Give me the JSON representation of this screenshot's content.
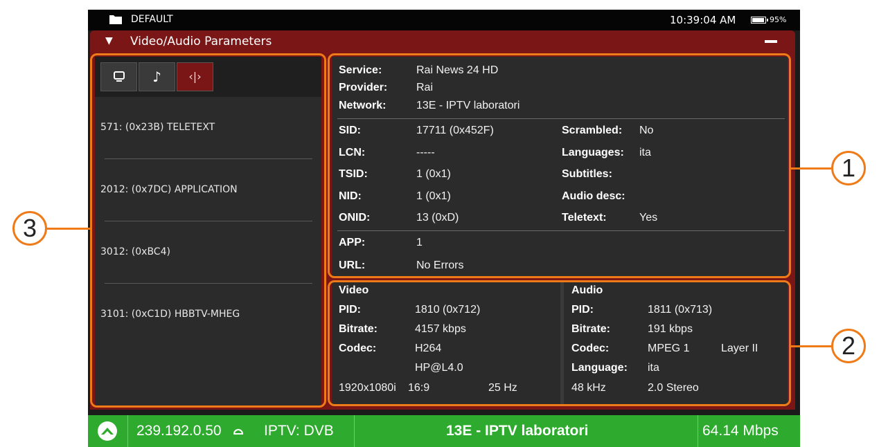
{
  "status_bar": {
    "folder_icon": "folder-icon",
    "profile": "DEFAULT",
    "time": "10:39:04 AM",
    "battery_percent": "95%",
    "battery_level": 0.95
  },
  "panel": {
    "title": "Video/Audio Parameters",
    "collapse_icon": "triangle-down-icon",
    "minimize_icon": "minus-icon"
  },
  "left_panel": {
    "tabs": [
      {
        "icon": "monitor-icon",
        "glyph": "🖵"
      },
      {
        "icon": "music-note-icon",
        "glyph": "♪"
      },
      {
        "icon": "code-icon",
        "glyph": "‹|›"
      }
    ],
    "pid_list": [
      "571: (0x23B)   TELETEXT",
      "2012: (0x7DC)  APPLICATION",
      "3012: (0xBC4)",
      "3101: (0xC1D)  HBBTV-MHEG"
    ]
  },
  "service_info": {
    "service_label": "Service:",
    "service": "Rai News 24 HD",
    "provider_label": "Provider:",
    "provider": "Rai",
    "network_label": "Network:",
    "network": "13E - IPTV laboratori",
    "sid_label": "SID:",
    "sid": "17711 (0x452F)",
    "lcn_label": "LCN:",
    "lcn": "-----",
    "tsid_label": "TSID:",
    "tsid": "1 (0x1)",
    "nid_label": "NID:",
    "nid": "1 (0x1)",
    "onid_label": "ONID:",
    "onid": "13 (0xD)",
    "scrambled_label": "Scrambled:",
    "scrambled": "No",
    "languages_label": "Languages:",
    "languages": "ita",
    "subtitles_label": "Subtitles:",
    "audio_desc_label": "Audio desc:",
    "teletext_label": "Teletext:",
    "teletext": "Yes",
    "app_label": "APP:",
    "app": "1",
    "url_label": "URL:",
    "url": "No Errors"
  },
  "video": {
    "heading": "Video",
    "pid_label": "PID:",
    "pid": "1810 (0x712)",
    "bitrate_label": "Bitrate:",
    "bitrate": "4157 kbps",
    "codec_label": "Codec:",
    "codec": "H264",
    "profile": "HP@L4.0",
    "resolution": "1920x1080i",
    "aspect": "16:9",
    "frame_rate": "25 Hz"
  },
  "audio": {
    "heading": "Audio",
    "pid_label": "PID:",
    "pid": "1811 (0x713)",
    "bitrate_label": "Bitrate:",
    "bitrate": "191 kbps",
    "codec_label": "Codec:",
    "codec": "MPEG 1",
    "layer": "Layer II",
    "language_label": "Language:",
    "language": "ita",
    "sample_rate": "48 kHz",
    "channels": "2.0 Stereo"
  },
  "callouts": [
    "1",
    "2",
    "3"
  ],
  "bottom_bar": {
    "logo_icon": "mountain-logo-icon",
    "ip": "239.192.0.50",
    "input_icon": "signal-icon",
    "mode": "IPTV: DVB",
    "network": "13E - IPTV laboratori",
    "bitrate": "64.14 Mbps"
  },
  "colors": {
    "accent": "#7a1616",
    "callout": "#ef7a18",
    "status_green": "#2eab2e"
  }
}
